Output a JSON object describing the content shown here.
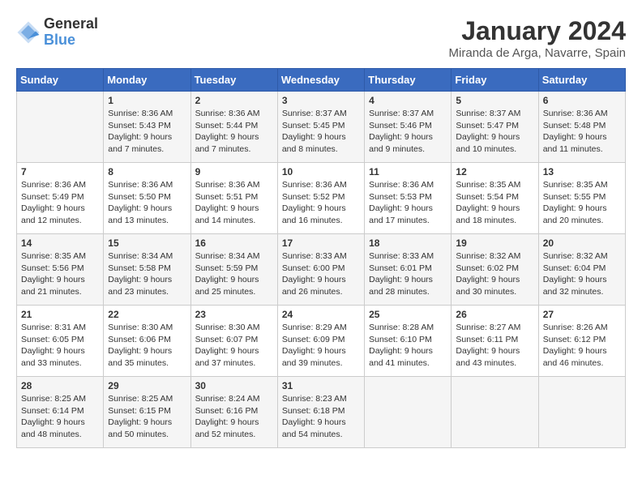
{
  "logo": {
    "general": "General",
    "blue": "Blue"
  },
  "title": "January 2024",
  "location": "Miranda de Arga, Navarre, Spain",
  "days_of_week": [
    "Sunday",
    "Monday",
    "Tuesday",
    "Wednesday",
    "Thursday",
    "Friday",
    "Saturday"
  ],
  "weeks": [
    [
      {
        "day": "",
        "sunrise": "",
        "sunset": "",
        "daylight": ""
      },
      {
        "day": "1",
        "sunrise": "Sunrise: 8:36 AM",
        "sunset": "Sunset: 5:43 PM",
        "daylight": "Daylight: 9 hours and 7 minutes."
      },
      {
        "day": "2",
        "sunrise": "Sunrise: 8:36 AM",
        "sunset": "Sunset: 5:44 PM",
        "daylight": "Daylight: 9 hours and 7 minutes."
      },
      {
        "day": "3",
        "sunrise": "Sunrise: 8:37 AM",
        "sunset": "Sunset: 5:45 PM",
        "daylight": "Daylight: 9 hours and 8 minutes."
      },
      {
        "day": "4",
        "sunrise": "Sunrise: 8:37 AM",
        "sunset": "Sunset: 5:46 PM",
        "daylight": "Daylight: 9 hours and 9 minutes."
      },
      {
        "day": "5",
        "sunrise": "Sunrise: 8:37 AM",
        "sunset": "Sunset: 5:47 PM",
        "daylight": "Daylight: 9 hours and 10 minutes."
      },
      {
        "day": "6",
        "sunrise": "Sunrise: 8:36 AM",
        "sunset": "Sunset: 5:48 PM",
        "daylight": "Daylight: 9 hours and 11 minutes."
      }
    ],
    [
      {
        "day": "7",
        "sunrise": "Sunrise: 8:36 AM",
        "sunset": "Sunset: 5:49 PM",
        "daylight": "Daylight: 9 hours and 12 minutes."
      },
      {
        "day": "8",
        "sunrise": "Sunrise: 8:36 AM",
        "sunset": "Sunset: 5:50 PM",
        "daylight": "Daylight: 9 hours and 13 minutes."
      },
      {
        "day": "9",
        "sunrise": "Sunrise: 8:36 AM",
        "sunset": "Sunset: 5:51 PM",
        "daylight": "Daylight: 9 hours and 14 minutes."
      },
      {
        "day": "10",
        "sunrise": "Sunrise: 8:36 AM",
        "sunset": "Sunset: 5:52 PM",
        "daylight": "Daylight: 9 hours and 16 minutes."
      },
      {
        "day": "11",
        "sunrise": "Sunrise: 8:36 AM",
        "sunset": "Sunset: 5:53 PM",
        "daylight": "Daylight: 9 hours and 17 minutes."
      },
      {
        "day": "12",
        "sunrise": "Sunrise: 8:35 AM",
        "sunset": "Sunset: 5:54 PM",
        "daylight": "Daylight: 9 hours and 18 minutes."
      },
      {
        "day": "13",
        "sunrise": "Sunrise: 8:35 AM",
        "sunset": "Sunset: 5:55 PM",
        "daylight": "Daylight: 9 hours and 20 minutes."
      }
    ],
    [
      {
        "day": "14",
        "sunrise": "Sunrise: 8:35 AM",
        "sunset": "Sunset: 5:56 PM",
        "daylight": "Daylight: 9 hours and 21 minutes."
      },
      {
        "day": "15",
        "sunrise": "Sunrise: 8:34 AM",
        "sunset": "Sunset: 5:58 PM",
        "daylight": "Daylight: 9 hours and 23 minutes."
      },
      {
        "day": "16",
        "sunrise": "Sunrise: 8:34 AM",
        "sunset": "Sunset: 5:59 PM",
        "daylight": "Daylight: 9 hours and 25 minutes."
      },
      {
        "day": "17",
        "sunrise": "Sunrise: 8:33 AM",
        "sunset": "Sunset: 6:00 PM",
        "daylight": "Daylight: 9 hours and 26 minutes."
      },
      {
        "day": "18",
        "sunrise": "Sunrise: 8:33 AM",
        "sunset": "Sunset: 6:01 PM",
        "daylight": "Daylight: 9 hours and 28 minutes."
      },
      {
        "day": "19",
        "sunrise": "Sunrise: 8:32 AM",
        "sunset": "Sunset: 6:02 PM",
        "daylight": "Daylight: 9 hours and 30 minutes."
      },
      {
        "day": "20",
        "sunrise": "Sunrise: 8:32 AM",
        "sunset": "Sunset: 6:04 PM",
        "daylight": "Daylight: 9 hours and 32 minutes."
      }
    ],
    [
      {
        "day": "21",
        "sunrise": "Sunrise: 8:31 AM",
        "sunset": "Sunset: 6:05 PM",
        "daylight": "Daylight: 9 hours and 33 minutes."
      },
      {
        "day": "22",
        "sunrise": "Sunrise: 8:30 AM",
        "sunset": "Sunset: 6:06 PM",
        "daylight": "Daylight: 9 hours and 35 minutes."
      },
      {
        "day": "23",
        "sunrise": "Sunrise: 8:30 AM",
        "sunset": "Sunset: 6:07 PM",
        "daylight": "Daylight: 9 hours and 37 minutes."
      },
      {
        "day": "24",
        "sunrise": "Sunrise: 8:29 AM",
        "sunset": "Sunset: 6:09 PM",
        "daylight": "Daylight: 9 hours and 39 minutes."
      },
      {
        "day": "25",
        "sunrise": "Sunrise: 8:28 AM",
        "sunset": "Sunset: 6:10 PM",
        "daylight": "Daylight: 9 hours and 41 minutes."
      },
      {
        "day": "26",
        "sunrise": "Sunrise: 8:27 AM",
        "sunset": "Sunset: 6:11 PM",
        "daylight": "Daylight: 9 hours and 43 minutes."
      },
      {
        "day": "27",
        "sunrise": "Sunrise: 8:26 AM",
        "sunset": "Sunset: 6:12 PM",
        "daylight": "Daylight: 9 hours and 46 minutes."
      }
    ],
    [
      {
        "day": "28",
        "sunrise": "Sunrise: 8:25 AM",
        "sunset": "Sunset: 6:14 PM",
        "daylight": "Daylight: 9 hours and 48 minutes."
      },
      {
        "day": "29",
        "sunrise": "Sunrise: 8:25 AM",
        "sunset": "Sunset: 6:15 PM",
        "daylight": "Daylight: 9 hours and 50 minutes."
      },
      {
        "day": "30",
        "sunrise": "Sunrise: 8:24 AM",
        "sunset": "Sunset: 6:16 PM",
        "daylight": "Daylight: 9 hours and 52 minutes."
      },
      {
        "day": "31",
        "sunrise": "Sunrise: 8:23 AM",
        "sunset": "Sunset: 6:18 PM",
        "daylight": "Daylight: 9 hours and 54 minutes."
      },
      {
        "day": "",
        "sunrise": "",
        "sunset": "",
        "daylight": ""
      },
      {
        "day": "",
        "sunrise": "",
        "sunset": "",
        "daylight": ""
      },
      {
        "day": "",
        "sunrise": "",
        "sunset": "",
        "daylight": ""
      }
    ]
  ]
}
